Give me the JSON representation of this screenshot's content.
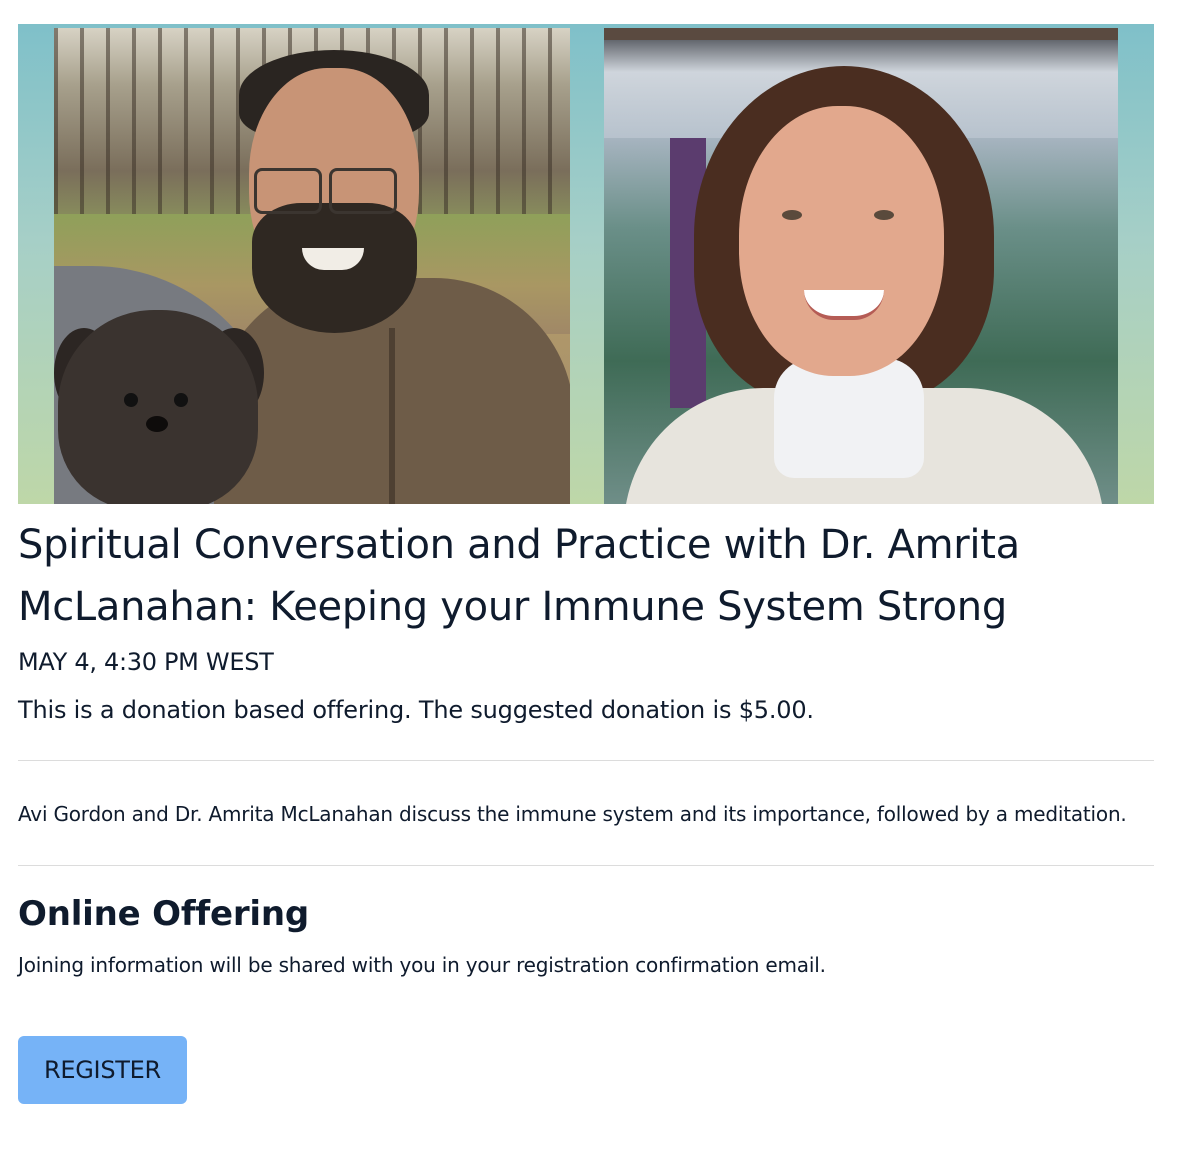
{
  "event": {
    "image_alt": "Avi Gordon with a dog and Dr. Amrita McLanahan",
    "title": "Spiritual Conversation and Practice with Dr. Amrita McLanahan: Keeping your Immune System Strong",
    "date": "MAY 4, 4:30 PM WEST",
    "donation": "This is a donation based offering. The suggested donation is $5.00.",
    "description": "Avi Gordon and Dr. Amrita McLanahan discuss the immune system and its importance, followed by a meditation."
  },
  "online": {
    "heading": "Online Offering",
    "info": "Joining information will be shared with you in your registration confirmation email."
  },
  "actions": {
    "register_label": "REGISTER"
  },
  "colors": {
    "text": "#0f1b2d",
    "button_bg": "#76b3f7",
    "divider": "#dcdcdc",
    "banner_top": "#7fc0c9",
    "banner_bottom": "#bed7a8"
  }
}
